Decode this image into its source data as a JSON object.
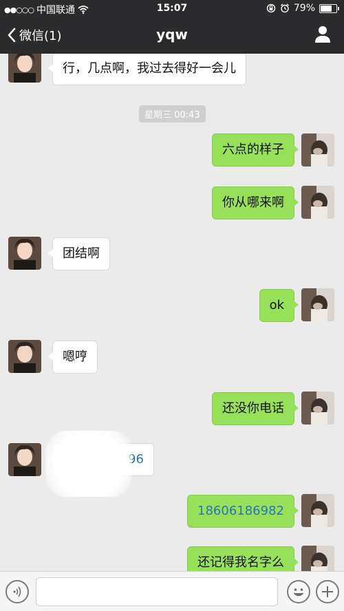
{
  "status_bar": {
    "signal_dots": "●●○○○",
    "carrier": "中国联通",
    "time": "15:07",
    "battery_percent": "79%",
    "battery_level": 0.79
  },
  "nav": {
    "back_label": "微信(1)",
    "title": "yqw"
  },
  "timestamp": "星期三 00:43",
  "messages": [
    {
      "side": "left",
      "text": "行，几点啊，我过去得好一会儿"
    },
    {
      "side": "right",
      "text": "六点的样子"
    },
    {
      "side": "right",
      "text": "你从哪来啊"
    },
    {
      "side": "left",
      "text": "团结啊"
    },
    {
      "side": "right",
      "text": "ok"
    },
    {
      "side": "left",
      "text": "嗯哼"
    },
    {
      "side": "right",
      "text": "还没你电话"
    },
    {
      "side": "left",
      "text": "96",
      "redacted": true
    },
    {
      "side": "right",
      "text": "18606186982",
      "link": true
    },
    {
      "side": "right",
      "text": "还记得我名字么"
    }
  ],
  "icons": {
    "back": "chevron-left-icon",
    "profile": "person-icon",
    "voice": "voice-icon",
    "emoji": "emoji-icon",
    "add": "plus-icon"
  },
  "colors": {
    "bar_background": "#2b2b2d",
    "chat_background": "#ebebeb",
    "outgoing_bubble": "#97e05a",
    "incoming_bubble": "#ffffff",
    "link": "#2a73b8"
  }
}
